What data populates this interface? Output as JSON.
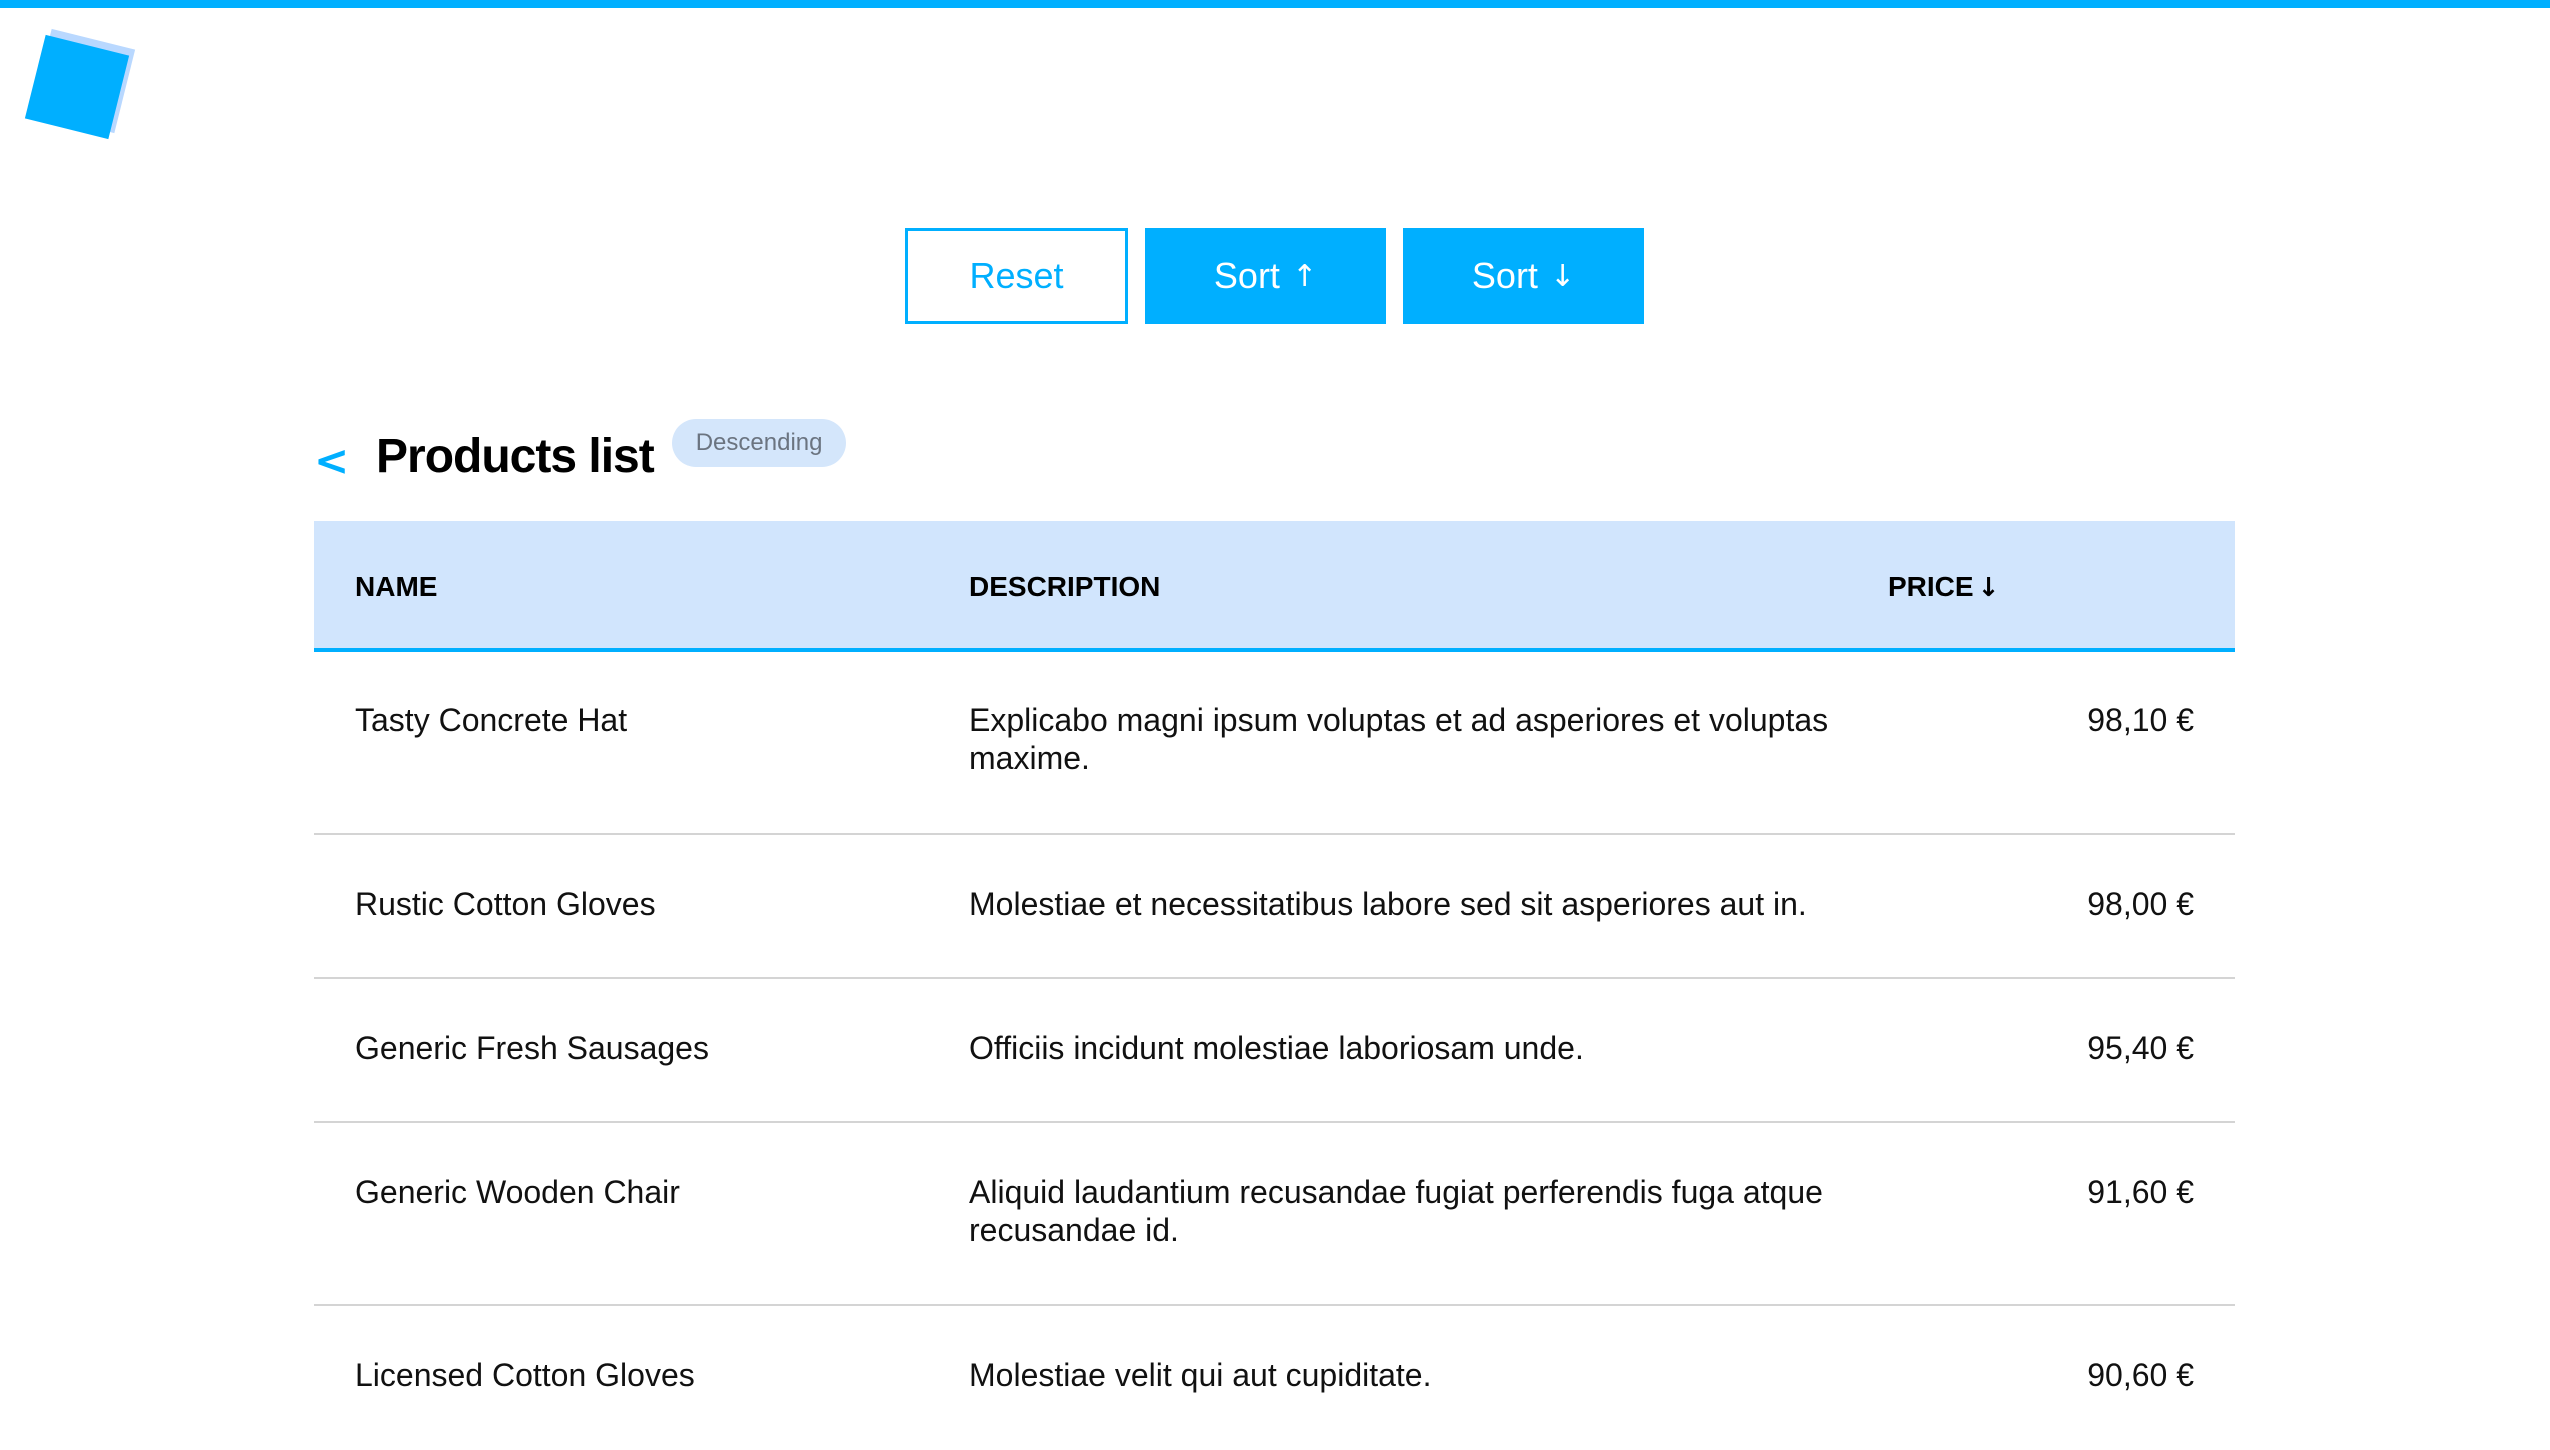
{
  "toolbar": {
    "reset_label": "Reset",
    "sort_asc_label": "Sort",
    "sort_asc_arrow": "↑",
    "sort_desc_label": "Sort",
    "sort_desc_arrow": "↓"
  },
  "header": {
    "back_icon": "<",
    "title": "Products list",
    "sort_badge": "Descending"
  },
  "table": {
    "columns": {
      "name": "NAME",
      "description": "DESCRIPTION",
      "price": "PRICE",
      "price_sort_arrow": "↓"
    },
    "rows": [
      {
        "name": "Tasty Concrete Hat",
        "description": "Explicabo magni ipsum voluptas et ad asperiores et voluptas maxime.",
        "price": "98,10 €"
      },
      {
        "name": "Rustic Cotton Gloves",
        "description": "Molestiae et necessitatibus labore sed sit asperiores aut in.",
        "price": "98,00 €"
      },
      {
        "name": "Generic Fresh Sausages",
        "description": "Officiis incidunt molestiae laboriosam unde.",
        "price": "95,40 €"
      },
      {
        "name": "Generic Wooden Chair",
        "description": "Aliquid laudantium recusandae fugiat perferendis fuga atque recusandae id.",
        "price": "91,60 €"
      },
      {
        "name": "Licensed Cotton Gloves",
        "description": "Molestiae velit qui aut cupiditate.",
        "price": "90,60 €"
      }
    ]
  },
  "colors": {
    "accent": "#00afff",
    "header_bg": "#d1e5fd",
    "badge_bg": "#d4e6fb"
  },
  "icons": {
    "logo": "logo-icon",
    "back": "chevron-left-icon",
    "sort_asc": "arrow-up-icon",
    "sort_desc": "arrow-down-icon"
  }
}
